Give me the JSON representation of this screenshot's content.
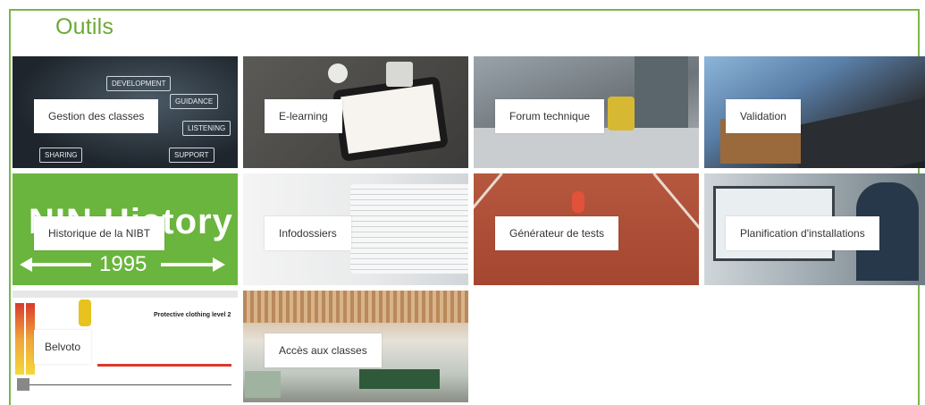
{
  "page": {
    "title": "Outils"
  },
  "tiles": [
    {
      "label": "Gestion des classes"
    },
    {
      "label": "E-learning"
    },
    {
      "label": "Forum technique"
    },
    {
      "label": "Validation"
    },
    {
      "label": "Historique de la NIBT"
    },
    {
      "label": "Infodossiers"
    },
    {
      "label": "Générateur de tests"
    },
    {
      "label": "Planification d'installations"
    },
    {
      "label": "Belvoto"
    },
    {
      "label": "Accès aux classes"
    }
  ],
  "tile_images": {
    "classes_words": [
      "DEVELOPMENT",
      "GUIDANCE",
      "LISTENING",
      "SHARING",
      "SUPPORT"
    ],
    "nibt_banner": "NIN History",
    "nibt_year": "1995",
    "belvoto_heading": "Protective clothing level 2"
  },
  "colors": {
    "accent": "#7ab648",
    "title": "#6aaa35",
    "selected_border": "#d9362b"
  }
}
